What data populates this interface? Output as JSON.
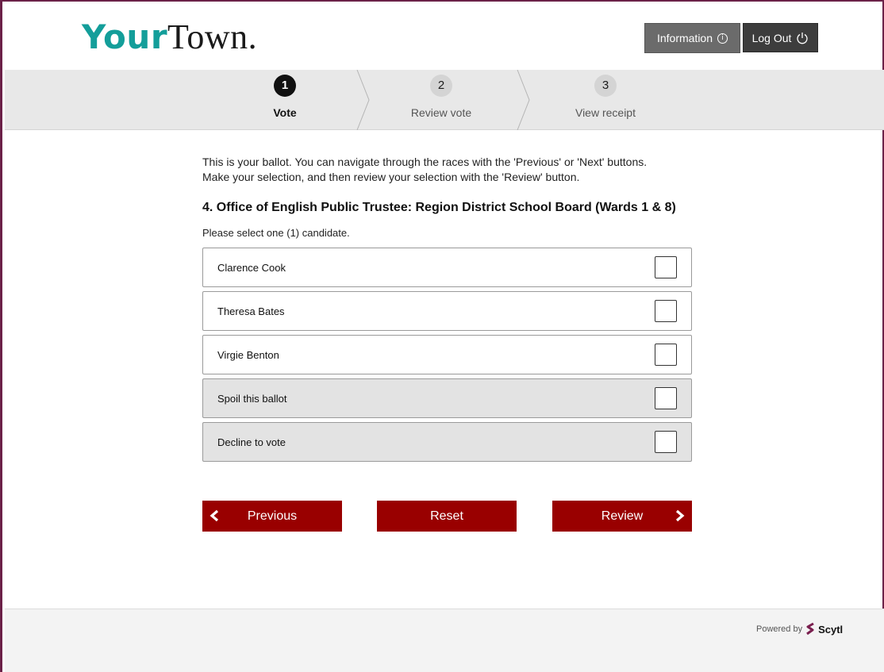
{
  "header": {
    "logo_your": "Your",
    "logo_town": "Town.",
    "information_label": "Information",
    "information_icon": "info-circle-icon",
    "logout_label": "Log Out",
    "logout_icon": "power-icon"
  },
  "stepper": {
    "steps": [
      {
        "number": "1",
        "label": "Vote",
        "state": "active"
      },
      {
        "number": "2",
        "label": "Review vote",
        "state": "inactive"
      },
      {
        "number": "3",
        "label": "View receipt",
        "state": "inactive"
      }
    ]
  },
  "ballot": {
    "intro_line1": "This is your ballot. You can navigate through the races with the 'Previous' or 'Next' buttons.",
    "intro_line2": "Make your selection, and then review your selection with the 'Review' button.",
    "race_title": "4. Office of English Public Trustee: Region District School Board (Wards 1 & 8)",
    "instruction": "Please select one (1) candidate.",
    "options": [
      {
        "name": "Clarence Cook",
        "checked": false
      },
      {
        "name": "Theresa Bates",
        "checked": false
      },
      {
        "name": "Virgie Benton",
        "checked": false
      },
      {
        "name": "Spoil this ballot",
        "checked": false
      },
      {
        "name": "Decline to vote",
        "checked": false
      }
    ]
  },
  "navigation": {
    "previous_label": "Previous",
    "reset_label": "Reset",
    "review_label": "Review"
  },
  "footer": {
    "powered_by": "Powered by",
    "brand": "Scytl"
  },
  "colors": {
    "accent_teal": "#139e9a",
    "button_red": "#990000",
    "frame_border": "#6b2148"
  }
}
